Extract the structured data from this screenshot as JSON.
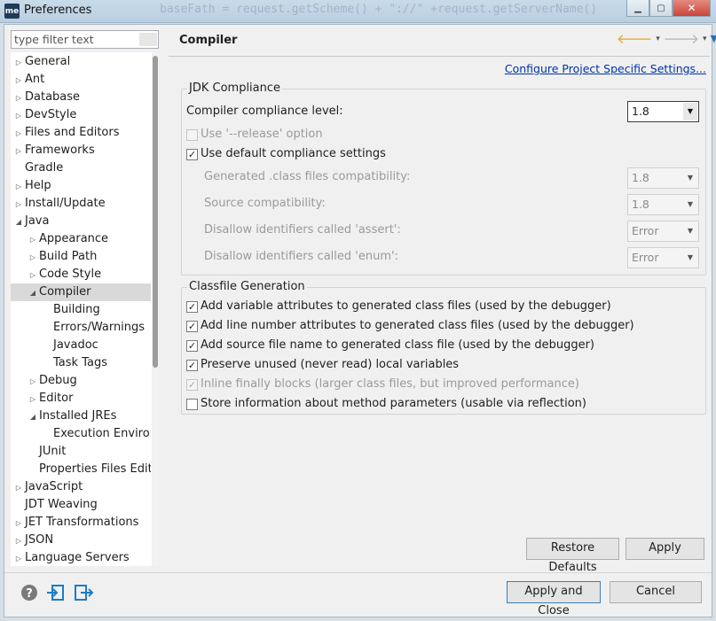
{
  "window": {
    "title": "Preferences",
    "app_icon_text": "me",
    "bg_code": "  baseFath = request.getScheme() + \"://\" +request.getServerName() +"
  },
  "filter": {
    "placeholder": "type filter text"
  },
  "tree": {
    "items": [
      {
        "label": "General",
        "indent": 0,
        "arrow": "right",
        "selected": false
      },
      {
        "label": "Ant",
        "indent": 0,
        "arrow": "right",
        "selected": false
      },
      {
        "label": "Database",
        "indent": 0,
        "arrow": "right",
        "selected": false
      },
      {
        "label": "DevStyle",
        "indent": 0,
        "arrow": "right",
        "selected": false
      },
      {
        "label": "Files and Editors",
        "indent": 0,
        "arrow": "right",
        "selected": false
      },
      {
        "label": "Frameworks",
        "indent": 0,
        "arrow": "right",
        "selected": false
      },
      {
        "label": "Gradle",
        "indent": 0,
        "arrow": "none",
        "selected": false
      },
      {
        "label": "Help",
        "indent": 0,
        "arrow": "right",
        "selected": false
      },
      {
        "label": "Install/Update",
        "indent": 0,
        "arrow": "right",
        "selected": false
      },
      {
        "label": "Java",
        "indent": 0,
        "arrow": "down",
        "selected": false
      },
      {
        "label": "Appearance",
        "indent": 1,
        "arrow": "right",
        "selected": false
      },
      {
        "label": "Build Path",
        "indent": 1,
        "arrow": "right",
        "selected": false
      },
      {
        "label": "Code Style",
        "indent": 1,
        "arrow": "right",
        "selected": false
      },
      {
        "label": "Compiler",
        "indent": 1,
        "arrow": "down",
        "selected": true
      },
      {
        "label": "Building",
        "indent": 2,
        "arrow": "none",
        "selected": false
      },
      {
        "label": "Errors/Warnings",
        "indent": 2,
        "arrow": "none",
        "selected": false
      },
      {
        "label": "Javadoc",
        "indent": 2,
        "arrow": "none",
        "selected": false
      },
      {
        "label": "Task Tags",
        "indent": 2,
        "arrow": "none",
        "selected": false
      },
      {
        "label": "Debug",
        "indent": 1,
        "arrow": "right",
        "selected": false
      },
      {
        "label": "Editor",
        "indent": 1,
        "arrow": "right",
        "selected": false
      },
      {
        "label": "Installed JREs",
        "indent": 1,
        "arrow": "down",
        "selected": false
      },
      {
        "label": "Execution Environ",
        "indent": 2,
        "arrow": "none",
        "selected": false
      },
      {
        "label": "JUnit",
        "indent": 1,
        "arrow": "none",
        "selected": false
      },
      {
        "label": "Properties Files Edito",
        "indent": 1,
        "arrow": "none",
        "selected": false
      },
      {
        "label": "JavaScript",
        "indent": 0,
        "arrow": "right",
        "selected": false
      },
      {
        "label": "JDT Weaving",
        "indent": 0,
        "arrow": "none",
        "selected": false
      },
      {
        "label": "JET Transformations",
        "indent": 0,
        "arrow": "right",
        "selected": false
      },
      {
        "label": "JSON",
        "indent": 0,
        "arrow": "right",
        "selected": false
      },
      {
        "label": "Language Servers",
        "indent": 0,
        "arrow": "right",
        "selected": false
      }
    ]
  },
  "header": {
    "title": "Compiler"
  },
  "configure_link": "Configure Project Specific Settings...",
  "jdk": {
    "title": "JDK Compliance",
    "level_label": "Compiler compliance level:",
    "level_value": "1.8",
    "release_label": "Use '--release' option",
    "default_label": "Use default compliance settings",
    "generated_label": "Generated .class files compatibility:",
    "generated_value": "1.8",
    "source_label": "Source compatibility:",
    "source_value": "1.8",
    "assert_label": "Disallow identifiers called 'assert':",
    "assert_value": "Error",
    "enum_label": "Disallow identifiers called 'enum':",
    "enum_value": "Error"
  },
  "classfile": {
    "title": "Classfile Generation",
    "options": [
      {
        "label": "Add variable attributes to generated class files (used by the debugger)",
        "checked": true,
        "disabled": false
      },
      {
        "label": "Add line number attributes to generated class files (used by the debugger)",
        "checked": true,
        "disabled": false
      },
      {
        "label": "Add source file name to generated class file (used by the debugger)",
        "checked": true,
        "disabled": false
      },
      {
        "label": "Preserve unused (never read) local variables",
        "checked": true,
        "disabled": false
      },
      {
        "label": "Inline finally blocks (larger class files, but improved performance)",
        "checked": true,
        "disabled": true
      },
      {
        "label": "Store information about method parameters (usable via reflection)",
        "checked": false,
        "disabled": false
      }
    ]
  },
  "buttons": {
    "restore": "Restore Defaults",
    "apply": "Apply",
    "apply_close": "Apply and Close",
    "cancel": "Cancel"
  }
}
